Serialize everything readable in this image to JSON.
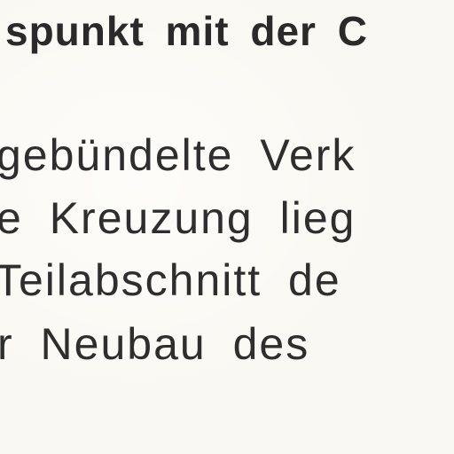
{
  "document": {
    "heading": "spunkt mit der C",
    "lines": [
      "gebündelte  Verk",
      "e Kreuzung lieg",
      "Teilabschnitt de",
      "r Neubau des"
    ]
  }
}
